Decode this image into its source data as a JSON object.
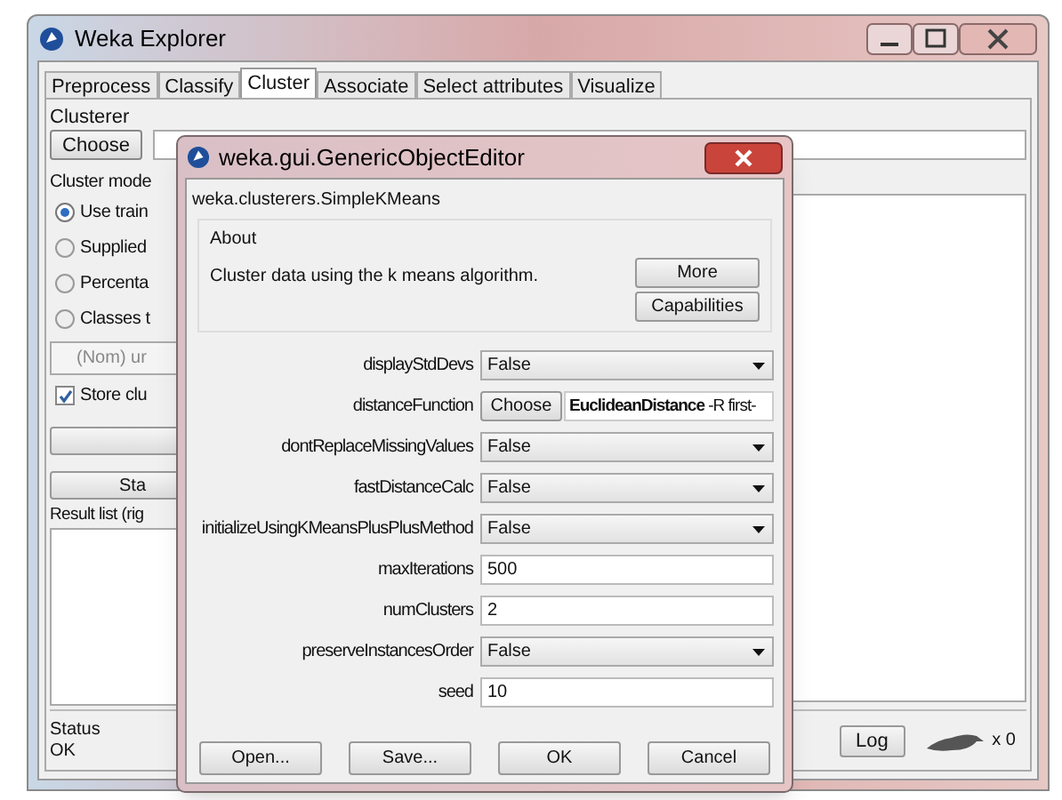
{
  "window": {
    "title": "Weka Explorer"
  },
  "tabs": [
    {
      "label": "Preprocess",
      "selected": false
    },
    {
      "label": "Classify",
      "selected": false
    },
    {
      "label": "Cluster",
      "selected": true
    },
    {
      "label": "Associate",
      "selected": false
    },
    {
      "label": "Select attributes",
      "selected": false
    },
    {
      "label": "Visualize",
      "selected": false
    }
  ],
  "clusterer": {
    "label": "Clusterer",
    "choose_button": "Choose"
  },
  "cluster_mode": {
    "label": "Cluster mode",
    "options": [
      {
        "label": "Use train",
        "selected": true
      },
      {
        "label": "Supplied",
        "selected": false
      },
      {
        "label": "Percenta",
        "selected": false
      },
      {
        "label": "Classes t",
        "selected": false
      }
    ],
    "class_select": "(Nom) ur",
    "store_checkbox": {
      "label": "Store clu",
      "checked": true
    }
  },
  "start_button": "Sta",
  "result_list_label": "Result list (rig",
  "status": {
    "label": "Status",
    "text": "OK"
  },
  "log_button": "Log",
  "task_count": "x 0",
  "dialog": {
    "title": "weka.gui.GenericObjectEditor",
    "class_name": "weka.clusterers.SimpleKMeans",
    "about": {
      "label": "About",
      "text": "Cluster data using the k means algorithm.",
      "buttons": [
        "More",
        "Capabilities"
      ]
    },
    "properties": [
      {
        "kind": "select",
        "label": "displayStdDevs",
        "value": "False"
      },
      {
        "kind": "chooser",
        "label": "distanceFunction",
        "button": "Choose",
        "value": "**EuclideanDistance** -R first-"
      },
      {
        "kind": "select",
        "label": "dontReplaceMissingValues",
        "value": "False"
      },
      {
        "kind": "select",
        "label": "fastDistanceCalc",
        "value": "False"
      },
      {
        "kind": "select",
        "label": "initializeUsingKMeansPlusPlusMethod",
        "value": "False"
      },
      {
        "kind": "text",
        "label": "maxIterations",
        "value": "500"
      },
      {
        "kind": "text",
        "label": "numClusters",
        "value": "2"
      },
      {
        "kind": "select",
        "label": "preserveInstancesOrder",
        "value": "False"
      },
      {
        "kind": "text",
        "label": "seed",
        "value": "10"
      }
    ],
    "buttons": [
      "Open...",
      "Save...",
      "OK",
      "Cancel"
    ]
  }
}
